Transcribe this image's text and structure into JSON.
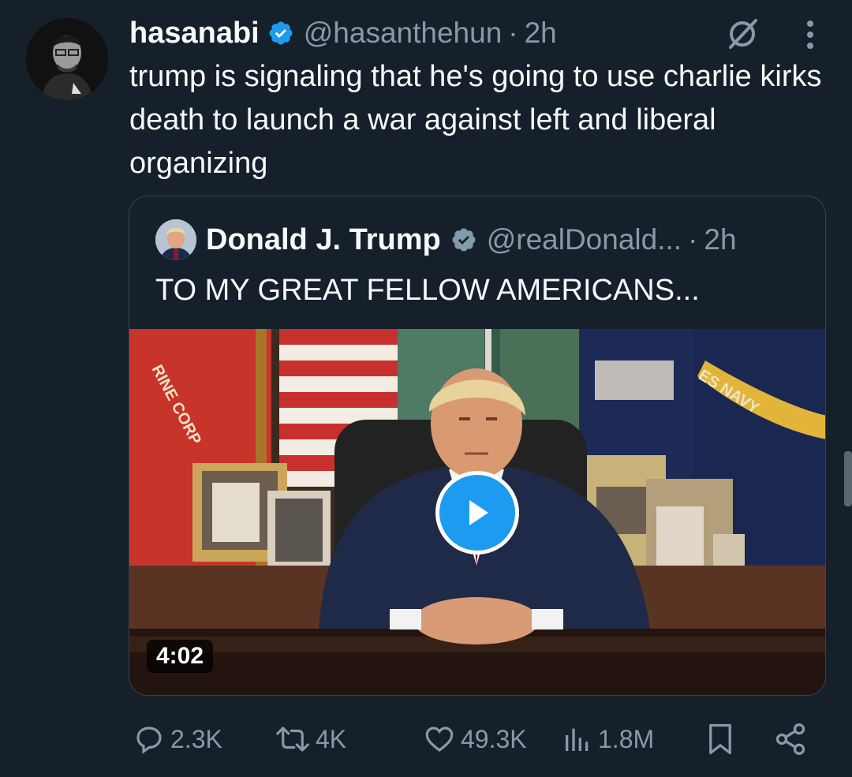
{
  "tweet": {
    "author": {
      "name": "hasanabi",
      "handle": "@hasanthehun",
      "separator": "·",
      "time": "2h"
    },
    "text": "trump is signaling that he's going to use charlie kirks death to launch a war against left and liberal organizing",
    "quote": {
      "author": {
        "name": "Donald J. Trump",
        "handle": "@realDonald...",
        "separator": "·",
        "time": "2h"
      },
      "text": "TO MY GREAT FELLOW AMERICANS...",
      "media": {
        "duration": "4:02",
        "flag_text_marine": "RINE CORP",
        "flag_text_navy": "ES NAVY"
      }
    },
    "stats": {
      "replies": "2.3K",
      "reposts": "4K",
      "likes": "49.3K",
      "views": "1.8M"
    }
  },
  "icons": {
    "verified": "verified-badge-icon",
    "grok": "grok-icon",
    "more": "more-vertical-icon",
    "reply": "reply-icon",
    "repost": "repost-icon",
    "like": "heart-icon",
    "views": "views-icon",
    "bookmark": "bookmark-icon",
    "share": "share-icon",
    "play": "play-icon"
  },
  "colors": {
    "background": "#15202b",
    "text": "#f7f9f9",
    "secondary": "#8b98a5",
    "accent": "#1d9bf0",
    "border": "#38444d"
  }
}
